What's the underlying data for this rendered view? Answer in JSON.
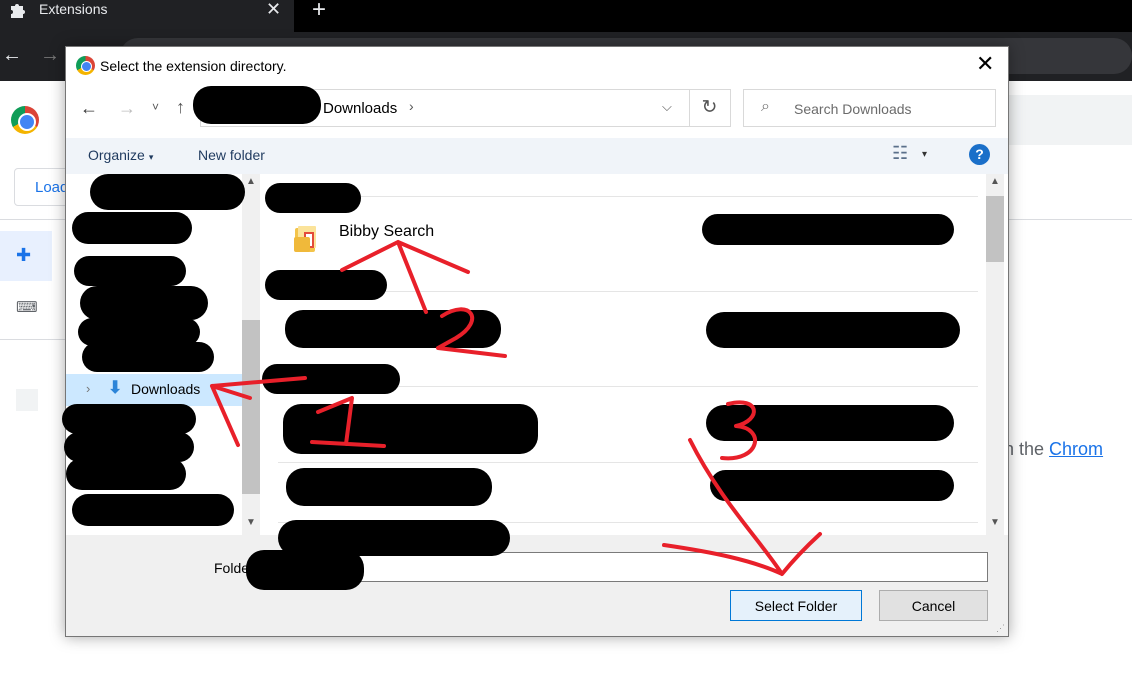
{
  "browser": {
    "tab_title": "Extensions",
    "tab_close": "✕",
    "new_tab": "+",
    "back": "←",
    "forward": "→"
  },
  "ext_page": {
    "load_button_label": "Load",
    "body_text": "s in the ",
    "body_link": "Chrom"
  },
  "dialog": {
    "title": "Select the extension directory.",
    "close": "✕",
    "address": {
      "back": "←",
      "forward": "→",
      "recent": "˅",
      "up": "↑",
      "current_segment": "Downloads",
      "separator": "›",
      "dropdown": "⌵",
      "refresh": "↻"
    },
    "search": {
      "icon": "⌕",
      "placeholder": "Search Downloads"
    },
    "commandbar": {
      "organize": "Organize",
      "organize_caret": "▾",
      "new_folder": "New folder",
      "view_icon": "☷",
      "view_caret": "▾",
      "help": "?"
    },
    "nav": {
      "selected_item": "Downloads",
      "chevron": "›",
      "download_icon": "⬇"
    },
    "files": {
      "folder_name": "Bibby Search"
    },
    "bottom": {
      "folder_label": "Folde",
      "folder_value": "",
      "select_button": "Select Folder",
      "cancel_button": "Cancel"
    }
  },
  "annotations": [
    "1",
    "2",
    "3"
  ],
  "colors": {
    "annotation_red": "#e8202a",
    "accent_blue": "#0078d7",
    "selection_blue": "#cce8ff"
  }
}
